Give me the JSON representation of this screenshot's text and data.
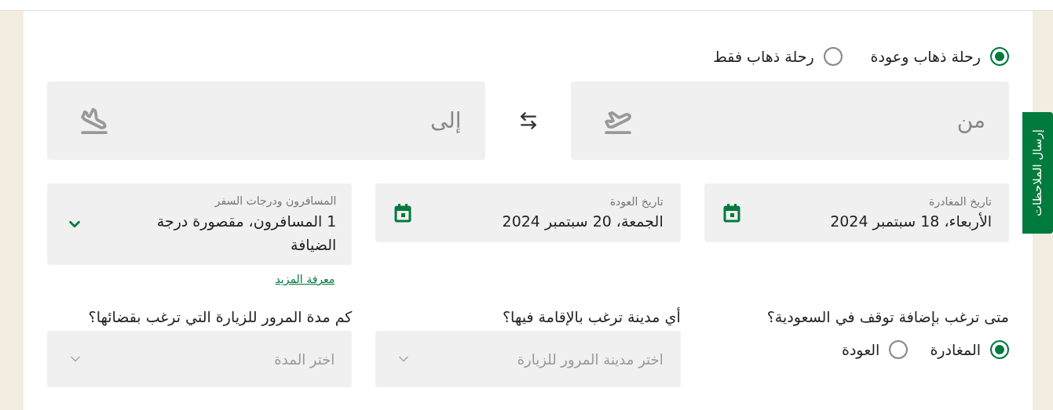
{
  "trip_type": [
    {
      "label": "رحلة ذهاب وعودة",
      "selected": true
    },
    {
      "label": "رحلة ذهاب فقط",
      "selected": false
    }
  ],
  "origin": {
    "placeholder": "من"
  },
  "destination": {
    "placeholder": "إلى"
  },
  "departure_date": {
    "label": "تاريخ المغادرة",
    "value": "الأربعاء، 18 سبتمبر 2024"
  },
  "return_date": {
    "label": "تاريخ العودة",
    "value": "الجمعة، 20 سبتمبر 2024"
  },
  "passengers": {
    "label": "المسافرون ودرجات السفر",
    "value": "1 المسافرون، مقصورة درجة الضيافة",
    "link": "معرفة المزيد"
  },
  "stopover_when": {
    "question": "متى ترغب بإضافة توقف في السعودية؟",
    "options": [
      {
        "label": "المغادرة",
        "selected": true
      },
      {
        "label": "العودة",
        "selected": false
      }
    ]
  },
  "stopover_city": {
    "question": "أي مدينة ترغب بالإقامة فيها؟",
    "placeholder": "اختر مدينة المرور للزيارة"
  },
  "stopover_duration": {
    "question": "كم مدة المرور للزيارة التي ترغب بقضائها؟",
    "placeholder": "اختر المدة"
  },
  "feedback_tab": "إرسال الملاحظات"
}
